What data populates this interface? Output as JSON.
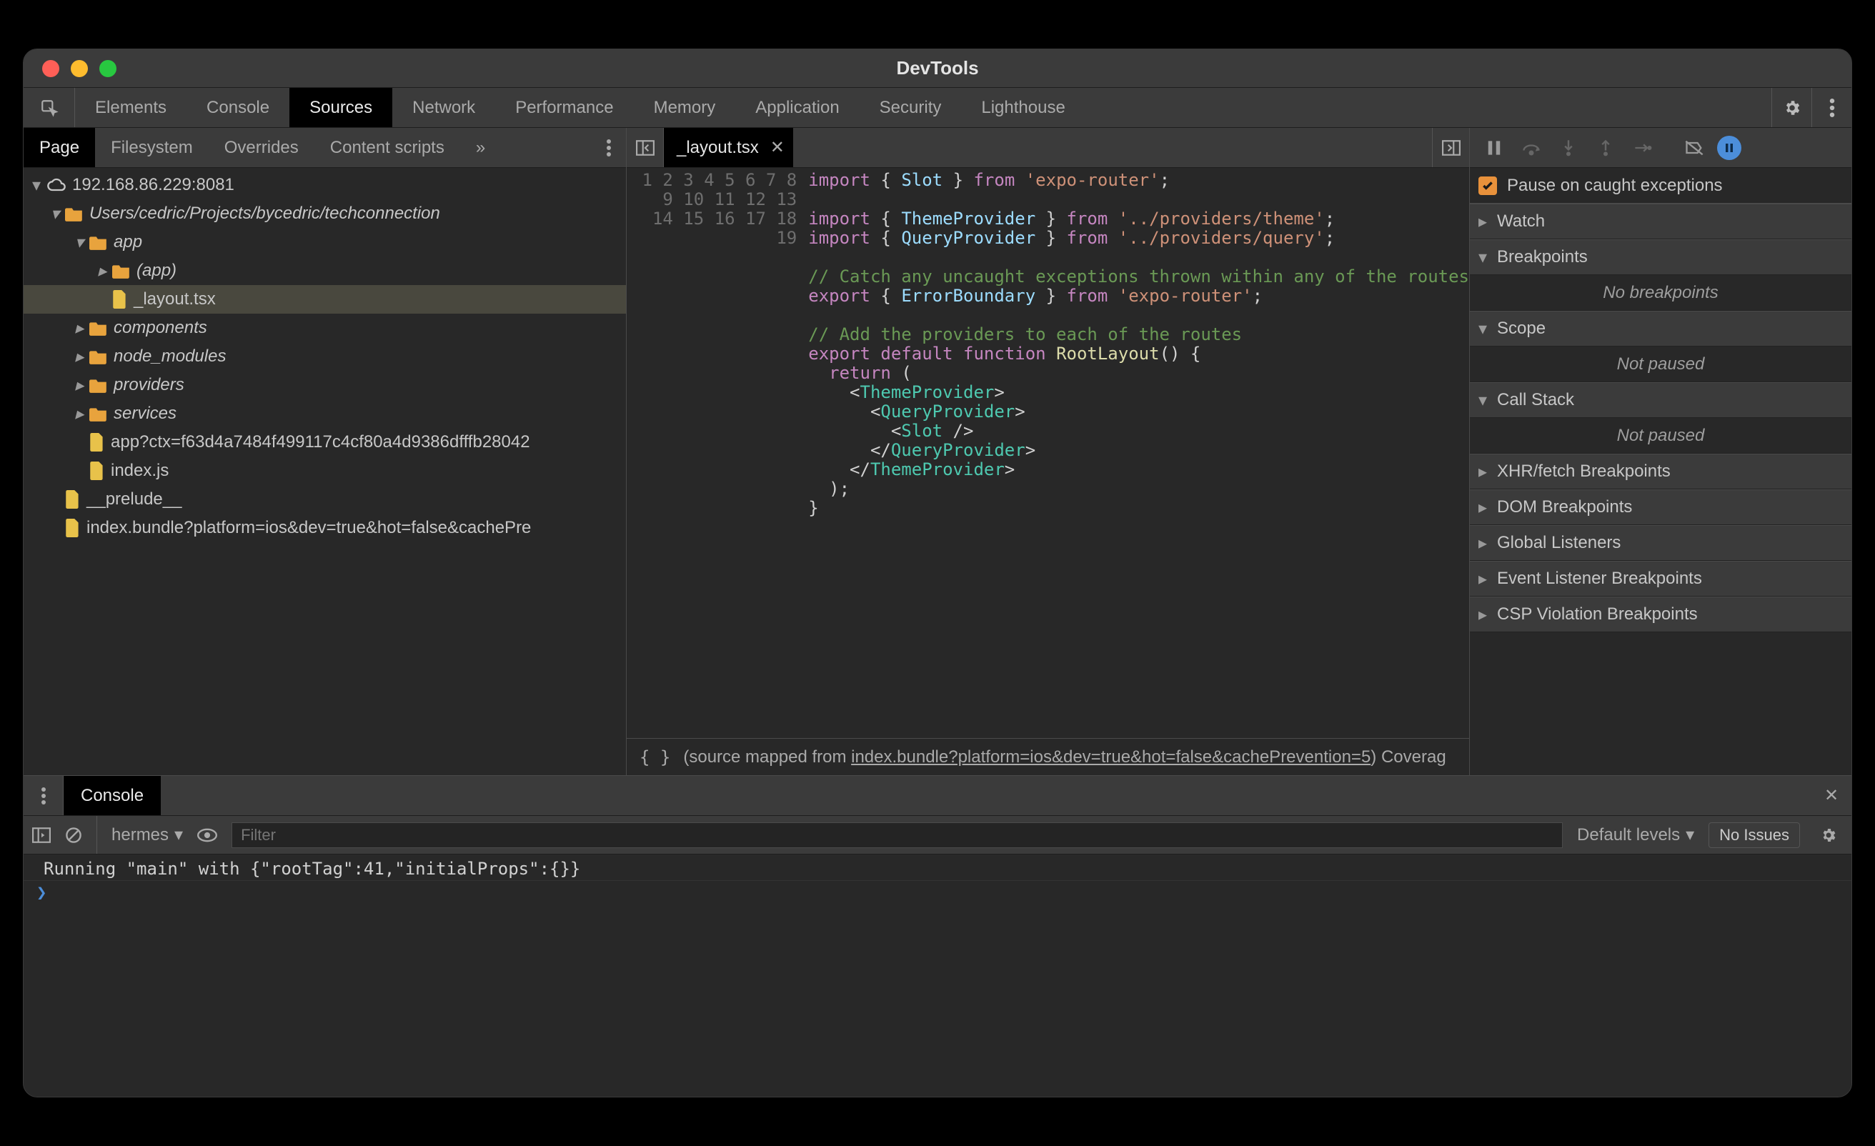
{
  "window_title": "DevTools",
  "main_tabs": [
    "Elements",
    "Console",
    "Sources",
    "Network",
    "Performance",
    "Memory",
    "Application",
    "Security",
    "Lighthouse"
  ],
  "main_tab_active": "Sources",
  "sub_tabs": [
    "Page",
    "Filesystem",
    "Overrides",
    "Content scripts"
  ],
  "sub_tab_active": "Page",
  "tree": {
    "root": "192.168.86.229:8081",
    "proj": "Users/cedric/Projects/bycedric/techconnection",
    "app": "app",
    "app_group": "(app)",
    "layout_file": "_layout.tsx",
    "components": "components",
    "node_modules": "node_modules",
    "providers": "providers",
    "services": "services",
    "appctx": "app?ctx=f63d4a7484f499117c4cf80a4d9386dfffb28042",
    "indexjs": "index.js",
    "prelude": "__prelude__",
    "bundle": "index.bundle?platform=ios&dev=true&hot=false&cachePre"
  },
  "editor": {
    "filename": "_layout.tsx",
    "line_count": 19,
    "status_prefix": "(source mapped from ",
    "status_link": "index.bundle?platform=ios&dev=true&hot=false&cachePrevention=5",
    "status_suffix": ")  Coverag"
  },
  "debugger": {
    "pause_caught_label": "Pause on caught exceptions",
    "pause_caught_checked": true,
    "watch": "Watch",
    "breakpoints": "Breakpoints",
    "breakpoints_msg": "No breakpoints",
    "scope": "Scope",
    "scope_msg": "Not paused",
    "callstack": "Call Stack",
    "callstack_msg": "Not paused",
    "xhr": "XHR/fetch Breakpoints",
    "dom": "DOM Breakpoints",
    "globals": "Global Listeners",
    "events": "Event Listener Breakpoints",
    "csp": "CSP Violation Breakpoints"
  },
  "drawer": {
    "tab": "Console",
    "context": "hermes",
    "filter_placeholder": "Filter",
    "levels": "Default levels",
    "no_issues": "No Issues",
    "log_line": "Running \"main\" with {\"rootTag\":41,\"initialProps\":{}}"
  }
}
